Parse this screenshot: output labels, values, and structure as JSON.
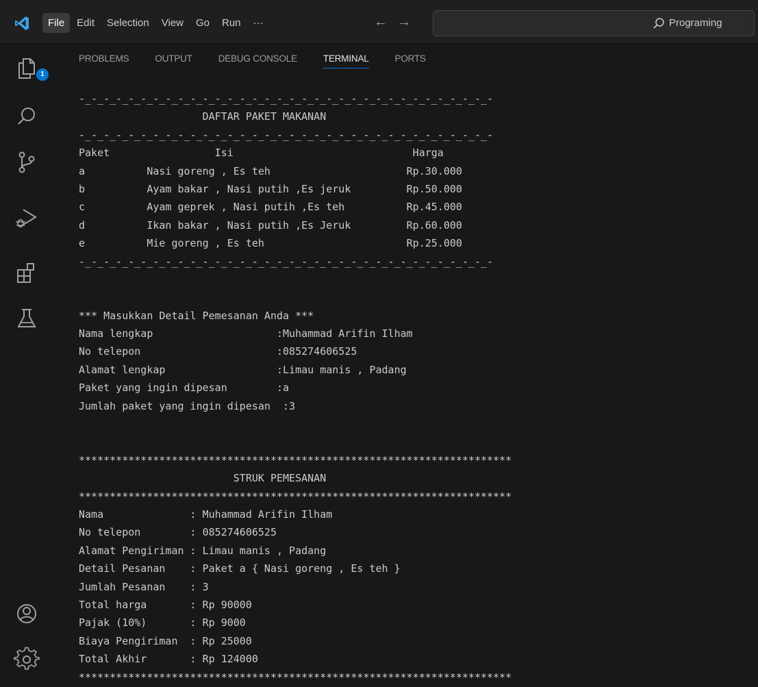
{
  "menu": {
    "items": [
      "File",
      "Edit",
      "Selection",
      "View",
      "Go",
      "Run",
      "···"
    ],
    "active": "File"
  },
  "nav": {
    "back": "←",
    "forward": "→"
  },
  "command_center": {
    "text": "Programing",
    "icon": "search-icon"
  },
  "activity_bar": {
    "icons": [
      "explorer-icon",
      "search-icon",
      "source-control-icon",
      "run-debug-icon",
      "extensions-icon",
      "testing-icon",
      "accounts-icon",
      "manage-gear-icon"
    ],
    "explorer_badge": "1"
  },
  "panel": {
    "tabs": [
      "PROBLEMS",
      "OUTPUT",
      "DEBUG CONSOLE",
      "TERMINAL",
      "PORTS"
    ],
    "active_tab": "TERMINAL"
  },
  "terminal": {
    "lines": [
      "-_-_-_-_-_-_-_-_-_-_-_-_-_-_-_-_-_-_-_-_-_-_-_-_-_-_-_-_-_-_-_-_-_-",
      "                    DAFTAR PAKET MAKANAN",
      "-_-_-_-_-_-_-_-_-_-_-_-_-_-_-_-_-_-_-_-_-_-_-_-_-_-_-_-_-_-_-_-_-_-",
      "Paket                 Isi                             Harga",
      "a          Nasi goreng , Es teh                      Rp.30.000",
      "b          Ayam bakar , Nasi putih ,Es jeruk         Rp.50.000",
      "c          Ayam geprek , Nasi putih ,Es teh          Rp.45.000",
      "d          Ikan bakar , Nasi putih ,Es Jeruk         Rp.60.000",
      "e          Mie goreng , Es teh                       Rp.25.000",
      "-_-_-_-_-_-_-_-_-_-_-_-_-_-_-_-_-_-_-_-_-_-_-_-_-_-_-_-_-_-_-_-_-_-",
      "",
      "",
      "*** Masukkan Detail Pemesanan Anda ***",
      "Nama lengkap                    :Muhammad Arifin Ilham",
      "No telepon                      :085274606525",
      "Alamat lengkap                  :Limau manis , Padang",
      "Paket yang ingin dipesan        :a",
      "Jumlah paket yang ingin dipesan  :3",
      "",
      "",
      "**********************************************************************",
      "                         STRUK PEMESANAN",
      "**********************************************************************",
      "Nama              : Muhammad Arifin Ilham",
      "No telepon        : 085274606525",
      "Alamat Pengiriman : Limau manis , Padang",
      "Detail Pesanan    : Paket a { Nasi goreng , Es teh }",
      "Jumlah Pesanan    : 3",
      "Total harga       : Rp 90000",
      "Pajak (10%)       : Rp 9000",
      "Biaya Pengiriman  : Rp 25000",
      "Total Akhir       : Rp 124000",
      "**********************************************************************"
    ]
  }
}
